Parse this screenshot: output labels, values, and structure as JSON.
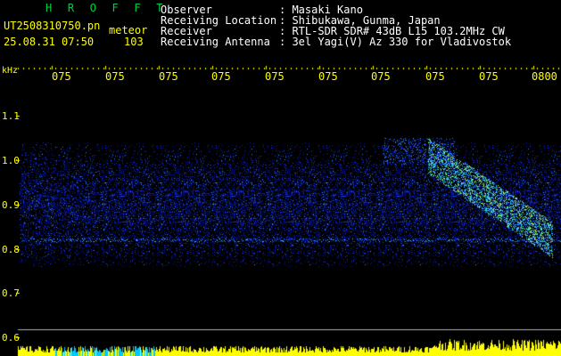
{
  "header": {
    "brand": "H R O F F T",
    "filename": "UT2508310750.pn",
    "event_type": "meteor",
    "datetime": "25.08.31 07:50",
    "count": "103"
  },
  "info": [
    {
      "label": "Observer",
      "value": ": Masaki Kano"
    },
    {
      "label": "Receiving Location",
      "value": ": Shibukawa, Gunma, Japan"
    },
    {
      "label": "Receiver",
      "value": ": RTL-SDR SDR# 43dB L15 103.2MHz CW"
    },
    {
      "label": "Receiving Antenna",
      "value": ": 3el Yagi(V) Az 330 for Vladivostok"
    }
  ],
  "axes": {
    "y_unit": "kHz",
    "y_ticks": [
      "1.1",
      "1.0",
      "0.9",
      "0.8",
      "0.7",
      "0.6"
    ],
    "x_ticks": [
      "075",
      "075",
      "075",
      "075",
      "075",
      "075",
      "075",
      "075",
      "075",
      "0800"
    ]
  },
  "colors": {
    "text_yellow": "#ffff00",
    "brand_green": "#00d040",
    "background": "#000000",
    "noise_blue": "#1a3cff"
  }
}
